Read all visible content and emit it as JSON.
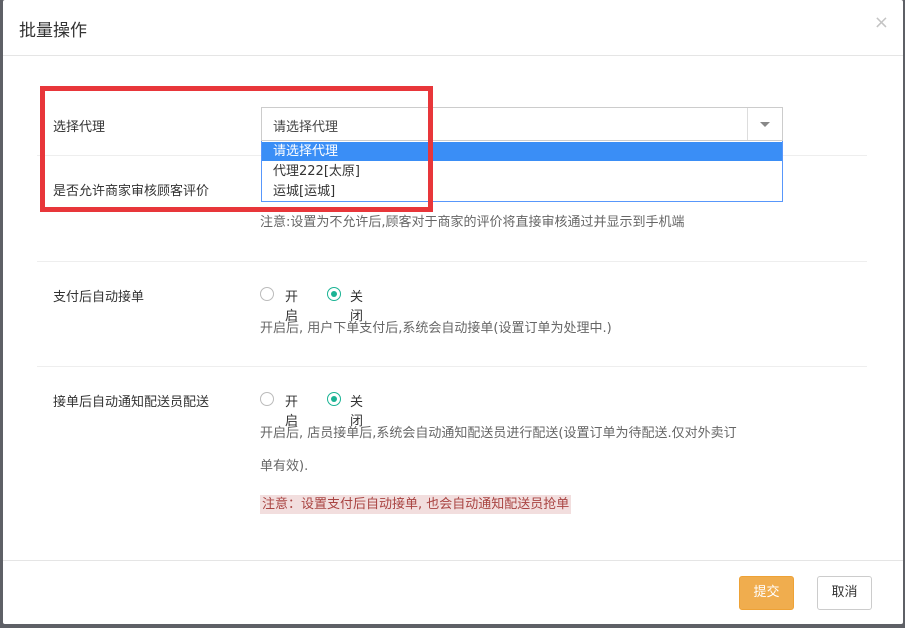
{
  "dialog": {
    "title": "批量操作",
    "close_symbol": "×"
  },
  "agent_row": {
    "label": "选择代理",
    "select_value": "请选择代理",
    "options": [
      "请选择代理",
      "代理222[太原]",
      "运城[运城]"
    ]
  },
  "review_row": {
    "label": "是否允许商家审核顾客评价",
    "note": "注意:设置为不允许后,顾客对于商家的评价将直接审核通过并显示到手机端"
  },
  "auto_accept_row": {
    "label": "支付后自动接单",
    "option_on": "开启",
    "option_off": "关闭",
    "selected": "关闭",
    "note": "开启后, 用户下单支付后,系统会自动接单(设置订单为处理中.)"
  },
  "auto_notify_row": {
    "label": "接单后自动通知配送员配送",
    "option_on": "开启",
    "option_off": "关闭",
    "selected": "关闭",
    "note_line1": "开启后, 店员接单后,系统会自动通知配送员进行配送(设置订单为待配送.仅对外卖订",
    "note_line2": "单有效).",
    "warning": "注意：设置支付后自动接单, 也会自动通知配送员抢单"
  },
  "footer": {
    "submit_label": "提交",
    "cancel_label": "取消"
  },
  "colors": {
    "accent": "#1ab394",
    "submit": "#f0ad4e",
    "highlight": "#e8363a",
    "selected_option": "#3a8ef6"
  }
}
